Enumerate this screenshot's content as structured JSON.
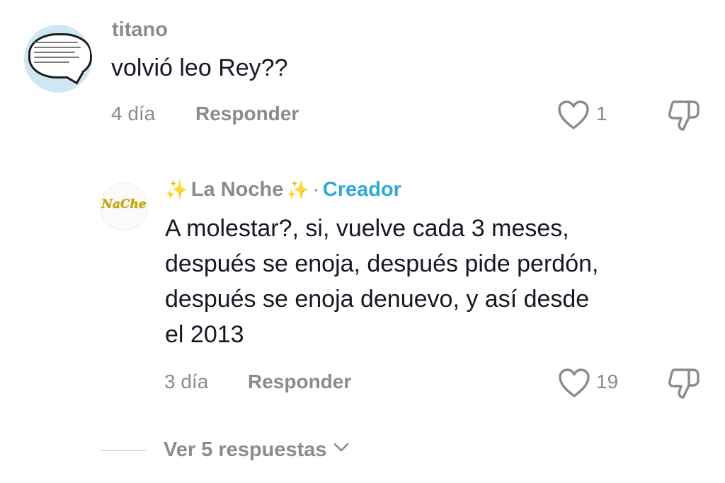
{
  "comments": [
    {
      "username": "titano",
      "text": "volvió leo Rey??",
      "time": "4 día",
      "reply_label": "Responder",
      "likes": "1"
    }
  ],
  "reply": {
    "username": "La Noche",
    "sparkle": "✨",
    "separator": "·",
    "badge": "Creador",
    "text_lines": [
      "A molestar?, si, vuelve cada 3 meses,",
      "después se enoja, después pide perdón,",
      "después se enoja denuevo, y así desde",
      "el 2013"
    ],
    "time": "3 día",
    "reply_label": "Responder",
    "likes": "19"
  },
  "view_more": {
    "label": "Ver 5 respuestas"
  },
  "colors": {
    "creator_badge": "#2ea9d8",
    "muted": "#8a8b91",
    "text": "#161823"
  },
  "icons": [
    "heart-icon",
    "dislike-icon",
    "chevron-down-icon",
    "sparkle-icon"
  ]
}
